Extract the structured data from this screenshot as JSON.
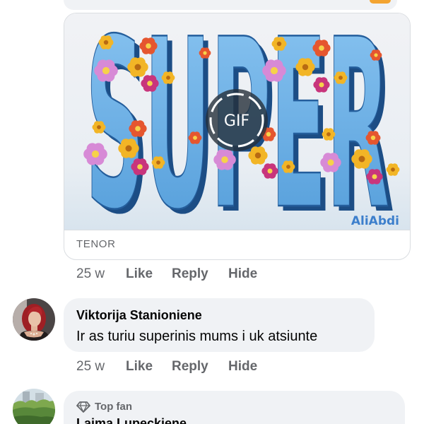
{
  "gif_comment": {
    "gif": {
      "image_text": "SUPER",
      "play_badge": "GIF",
      "watermark": "AliAbdi",
      "provider": "TENOR"
    },
    "actions": {
      "time": "25 w",
      "like": "Like",
      "reply": "Reply",
      "hide": "Hide"
    }
  },
  "comment_2": {
    "author": "Viktorija Stanioniene",
    "text": "Ir as turiu superinis mums i uk atsiunte",
    "actions": {
      "time": "25 w",
      "like": "Like",
      "reply": "Reply",
      "hide": "Hide"
    }
  },
  "comment_3": {
    "badge": "Top fan",
    "badge_icon": "diamond-icon",
    "author": "Laima Lupeckiene"
  },
  "colors": {
    "bubble_background": "#f0f2f5",
    "secondary_text": "#65676b",
    "primary_text": "#050505",
    "card_border": "#dadde1"
  }
}
